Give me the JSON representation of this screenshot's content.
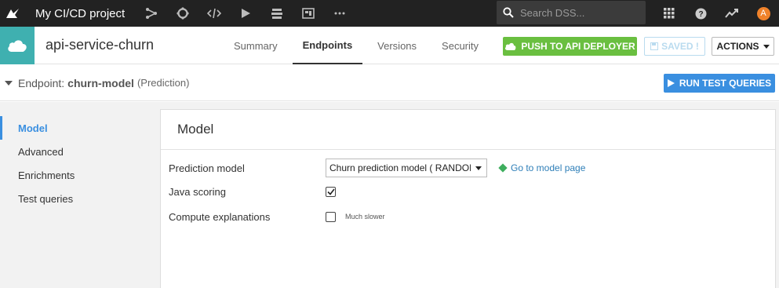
{
  "topbar": {
    "project_title": "My CI/CD project",
    "search_placeholder": "Search DSS...",
    "avatar_initial": "A",
    "nav_icons": [
      "flow-icon",
      "recipe-icon",
      "code-icon",
      "play-icon",
      "dataset-stack-icon",
      "dashboard-icon",
      "more-icon"
    ],
    "right_icons": [
      "apps-grid-icon",
      "help-icon",
      "trend-icon"
    ]
  },
  "service": {
    "name": "api-service-churn",
    "tabs": [
      {
        "label": "Summary",
        "active": false
      },
      {
        "label": "Endpoints",
        "active": true
      },
      {
        "label": "Versions",
        "active": false
      },
      {
        "label": "Security",
        "active": false
      }
    ],
    "push_label": "PUSH TO API DEPLOYER",
    "saved_label": "SAVED !",
    "actions_label": "ACTIONS"
  },
  "endpoint": {
    "prefix": "Endpoint:",
    "name": "churn-model",
    "type": "(Prediction)",
    "run_label": "RUN TEST QUERIES"
  },
  "sidebar": {
    "items": [
      {
        "label": "Model",
        "active": true
      },
      {
        "label": "Advanced",
        "active": false
      },
      {
        "label": "Enrichments",
        "active": false
      },
      {
        "label": "Test queries",
        "active": false
      }
    ]
  },
  "card": {
    "title": "Model",
    "prediction_model_label": "Prediction model",
    "prediction_model_value": "Churn prediction model ( RANDOM FOREST )",
    "goto_label": "Go to model page",
    "java_scoring_label": "Java scoring",
    "java_scoring_checked": true,
    "compute_explanations_label": "Compute explanations",
    "compute_explanations_checked": false,
    "compute_explanations_hint": "Much slower"
  },
  "colors": {
    "topbar": "#222222",
    "service_icon": "#3fb0b0",
    "push_button": "#6abf40",
    "run_button": "#3a8fe0",
    "active_nav": "#3a8fe0",
    "link": "#2f7fb8"
  }
}
